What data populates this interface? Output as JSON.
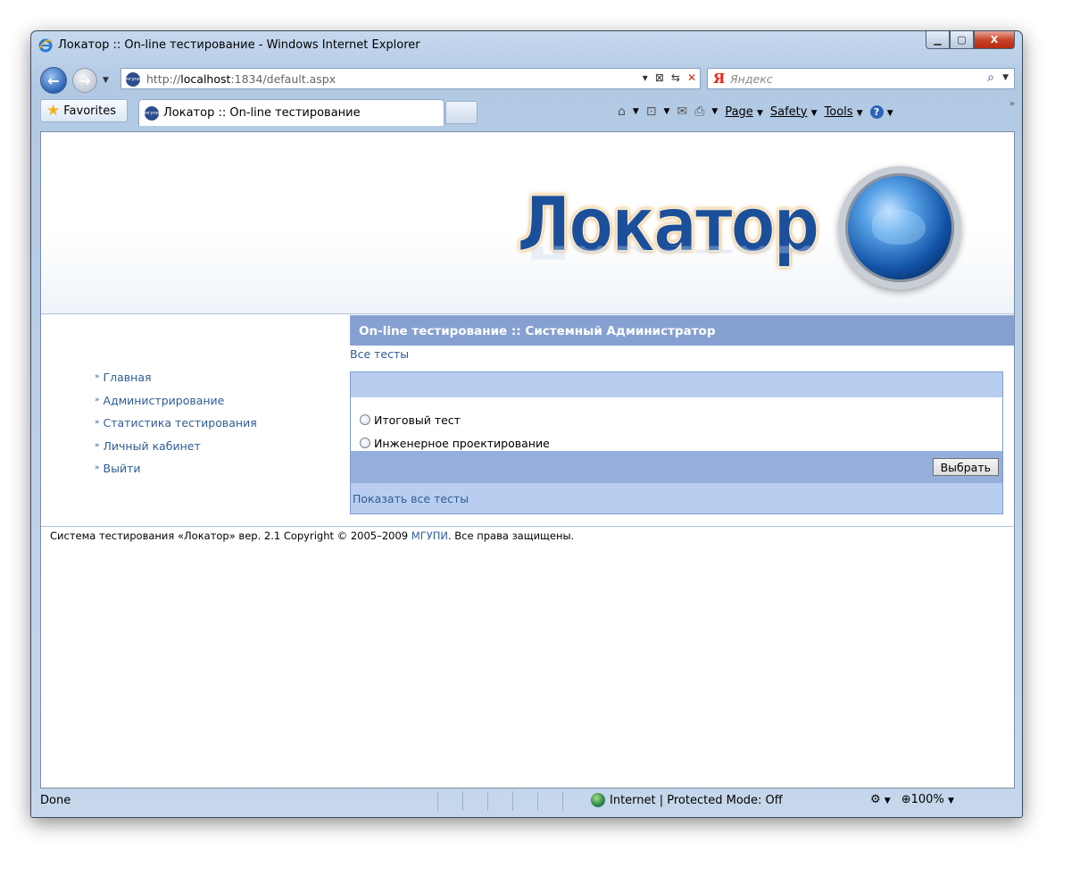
{
  "window": {
    "title": "Локатор :: On-line тестирование - Windows Internet Explorer",
    "minimize": "▁",
    "maximize": "▢",
    "close": "X"
  },
  "address_bar": {
    "url_prefix": "http://",
    "url_host": "localhost",
    "url_rest": ":1834/default.aspx",
    "site_icon_text": "мгупи"
  },
  "search": {
    "engine_logo": "Я",
    "placeholder": "Яндекс"
  },
  "tabs": {
    "favorites_label": "Favorites",
    "active_tab_label": "Локатор :: On-line тестирование"
  },
  "command_bar": {
    "page": "Page",
    "safety": "Safety",
    "tools": "Tools",
    "help": "?"
  },
  "site": {
    "logo_text": "Локатор",
    "main_title": "On-line тестирование :: Системный Администратор",
    "all_tests_link": "Все тесты",
    "nav": [
      {
        "label": "Главная"
      },
      {
        "label": "Администрирование"
      },
      {
        "label": "Статистика тестирования"
      },
      {
        "label": "Личный кабинет"
      },
      {
        "label": "Выйти"
      }
    ],
    "tests": [
      {
        "label": "Итоговый тест"
      },
      {
        "label": "Инженерное проектирование"
      }
    ],
    "choose_button": "Выбрать",
    "show_all_link": "Показать все тесты",
    "footer_pre": "Система тестирования «Локатор» вер. 2.1 Copyright © 2005–2009 ",
    "footer_link": "МГУПИ",
    "footer_post": ". Все права защищены."
  },
  "status_bar": {
    "status": "Done",
    "zone": "Internet | Protected Mode: Off",
    "zoom": "100%"
  },
  "colors": {
    "title_bar_blue": "#86a1d1",
    "panel_light": "#b8cdf0",
    "panel_mid": "#96aedc",
    "link_blue": "#2e5c95"
  }
}
